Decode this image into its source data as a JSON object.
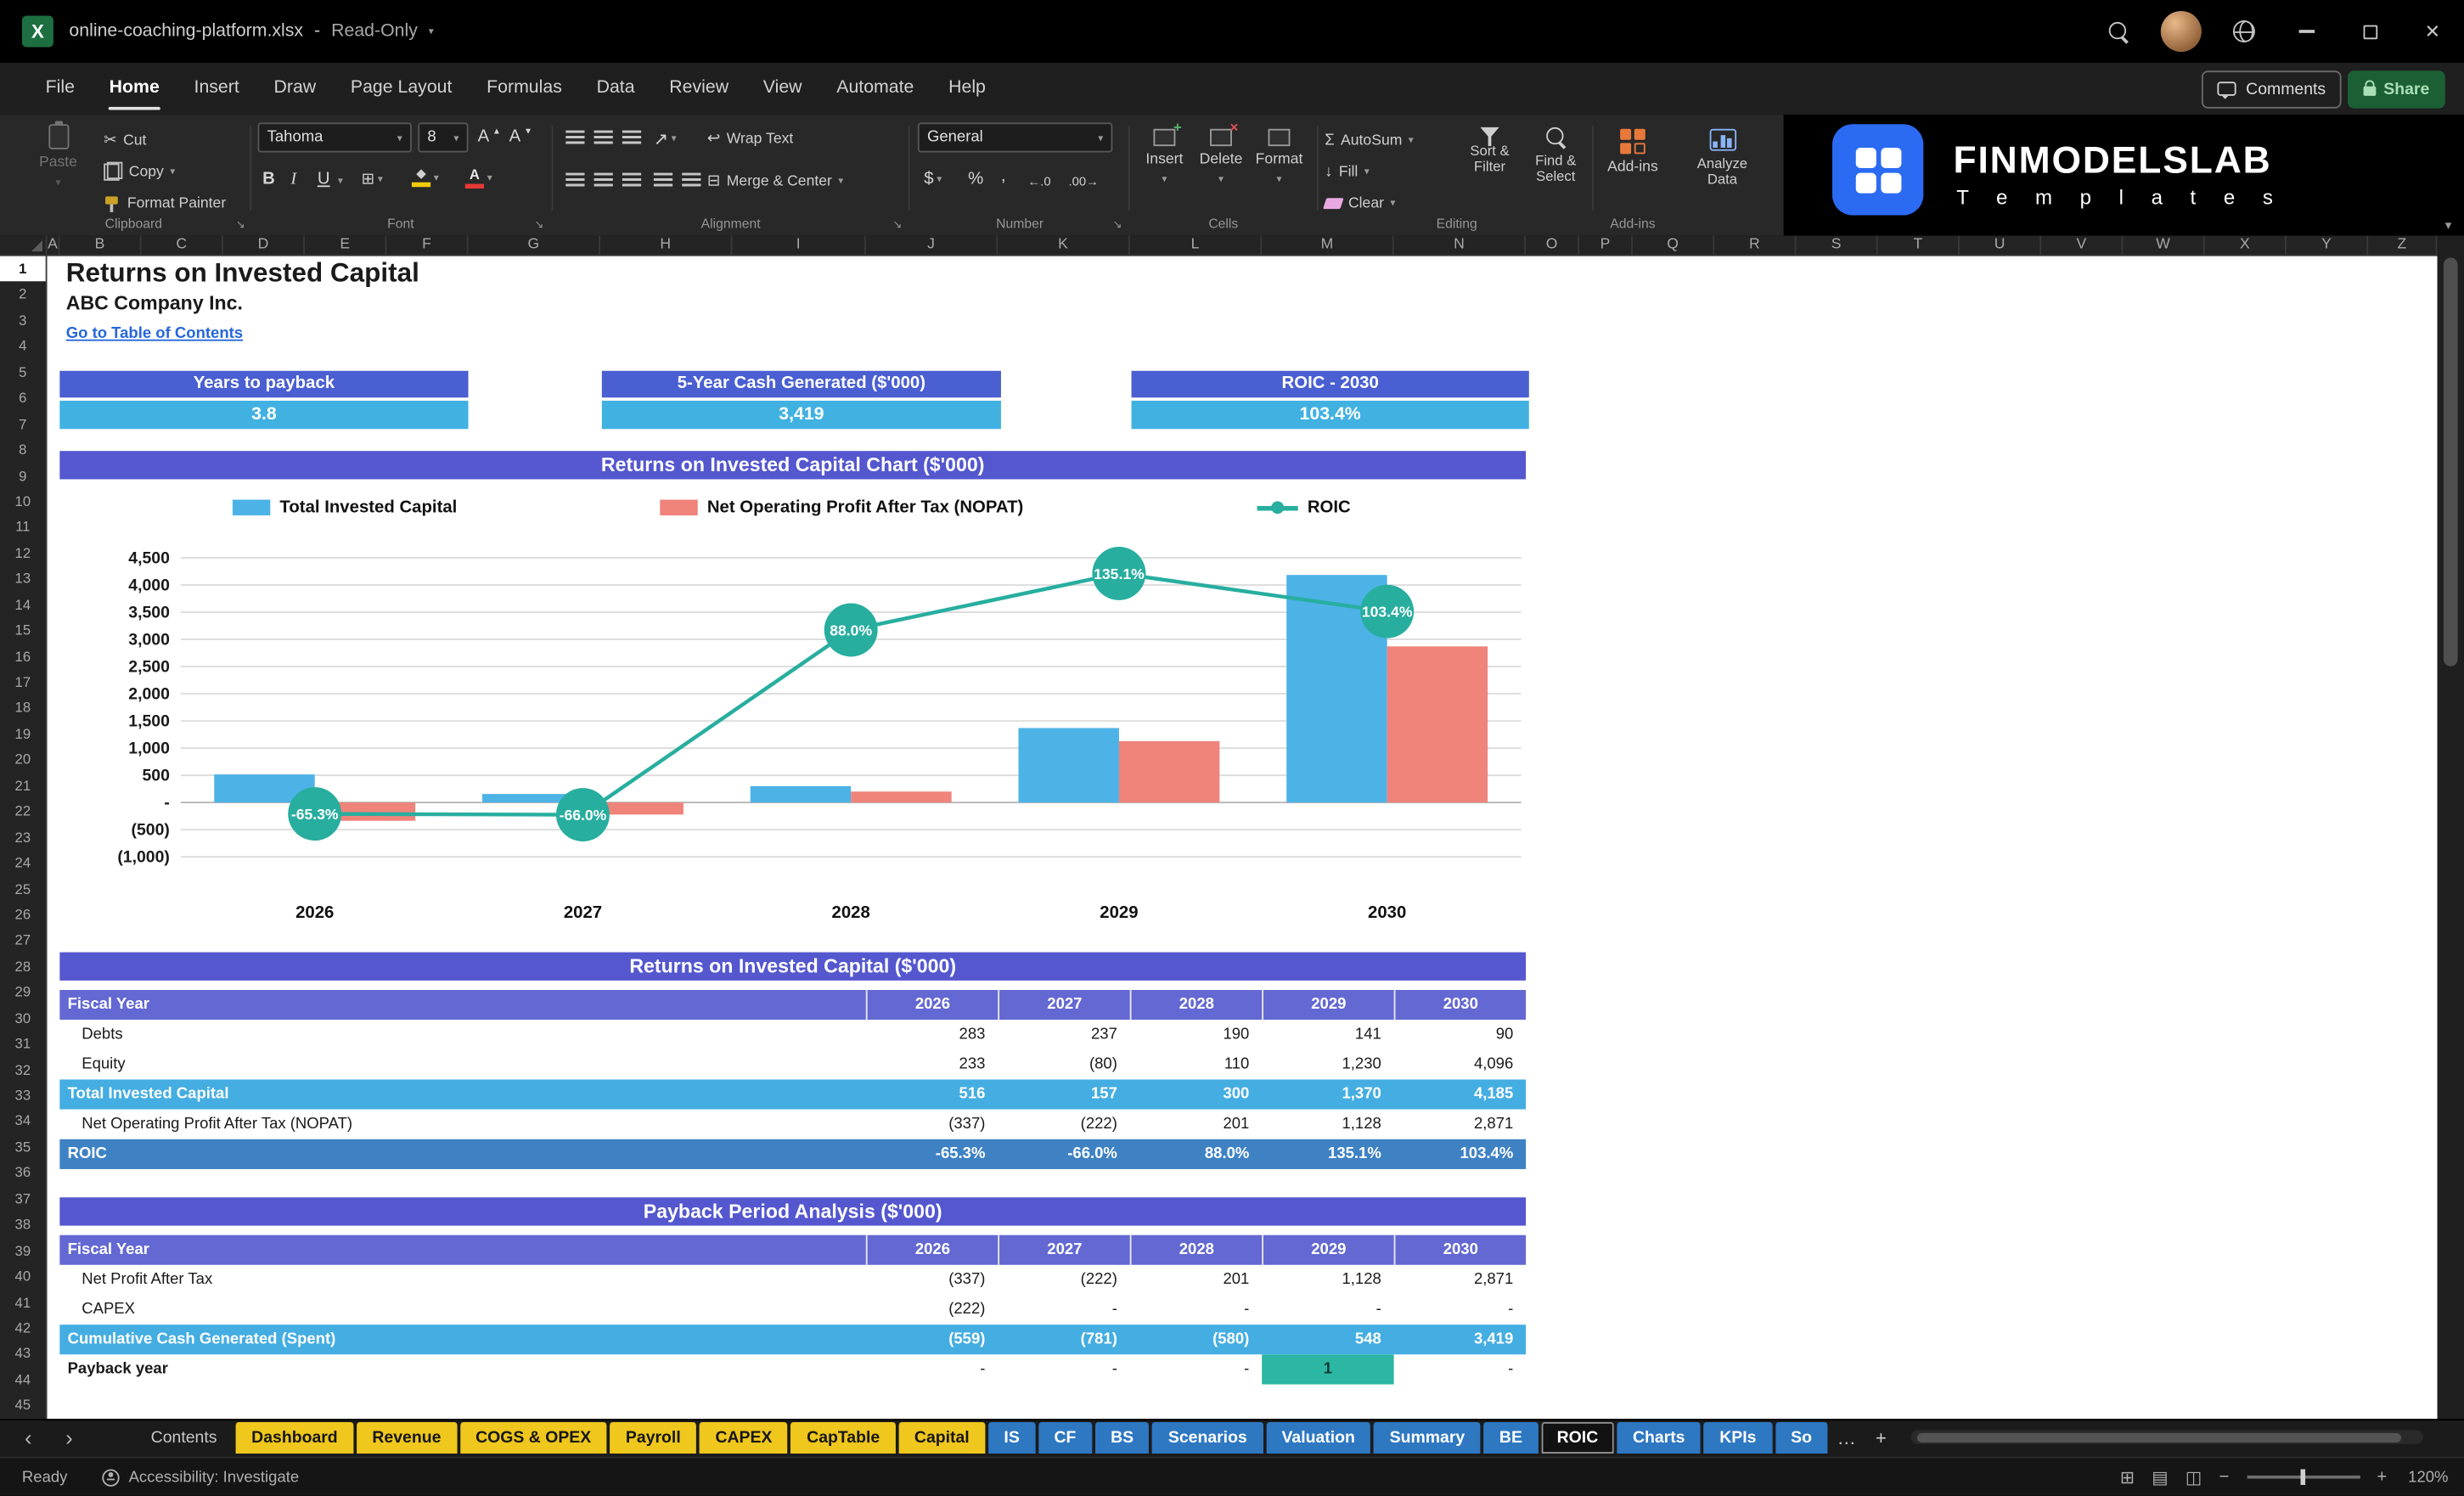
{
  "colors": {
    "banner": "#5457CE",
    "tableHeader": "#6468D2",
    "totalRow": "#44ADE2",
    "roicRow": "#3E82C4",
    "kpiHeader": "#4A5FD1",
    "kpiValue": "#41B1E1",
    "barBlue": "#4DB3E6",
    "barSalmon": "#F0837A",
    "teal": "#27AE9F",
    "tabYellow": "#EFC71D",
    "tabBlue": "#2E78C2",
    "link": "#2667D9",
    "payback": "#2CB6A4",
    "excelGreen": "#1D6F42",
    "brandBlue": "#2B6BF3"
  },
  "title_bar": {
    "file_name": "online-coaching-platform.xlsx",
    "separator": "-",
    "mode": "Read-Only"
  },
  "menu": {
    "items": [
      "File",
      "Home",
      "Insert",
      "Draw",
      "Page Layout",
      "Formulas",
      "Data",
      "Review",
      "View",
      "Automate",
      "Help"
    ],
    "active": "Home",
    "comments_label": "Comments",
    "share_label": "Share"
  },
  "ribbon": {
    "clipboard": {
      "label": "Clipboard",
      "paste": "Paste",
      "cut": "Cut",
      "copy": "Copy",
      "format_painter": "Format Painter"
    },
    "font": {
      "label": "Font",
      "family": "Tahoma",
      "size": "8",
      "bold": "B",
      "italic": "I",
      "underline": "U"
    },
    "alignment": {
      "label": "Alignment",
      "wrap_text": "Wrap Text",
      "merge_center": "Merge & Center"
    },
    "number": {
      "label": "Number",
      "format": "General",
      "currency": "$",
      "percent": "%",
      "comma": ","
    },
    "cells": {
      "label": "Cells",
      "insert": "Insert",
      "delete": "Delete",
      "format": "Format"
    },
    "editing": {
      "label": "Editing",
      "autosum": "AutoSum",
      "fill": "Fill",
      "clear": "Clear",
      "sort_filter": "Sort & Filter",
      "find_select": "Find & Select"
    },
    "addins": {
      "label": "Add-ins",
      "addins": "Add-ins",
      "analyze_data": "Analyze Data"
    }
  },
  "brand": {
    "name": "FINMODELSLAB",
    "subtitle": "T e m p l a t e s"
  },
  "grid": {
    "columns": [
      "A",
      "B",
      "C",
      "D",
      "E",
      "F",
      "G",
      "H",
      "I",
      "J",
      "K",
      "L",
      "M",
      "N",
      "O",
      "P",
      "Q",
      "R",
      "S",
      "T",
      "U",
      "V",
      "W",
      "X",
      "Y",
      "Z"
    ],
    "first_row": 1,
    "last_row": 45,
    "active_row": 1
  },
  "sheet": {
    "title": "Returns on Invested Capital",
    "company": "ABC Company Inc.",
    "toc_link": "Go to Table of Contents",
    "kpis": [
      {
        "label": "Years to payback",
        "value": "3.8"
      },
      {
        "label": "5-Year Cash Generated ($'000)",
        "value": "3,419"
      },
      {
        "label": "ROIC - 2030",
        "value": "103.4%"
      }
    ]
  },
  "chart_data": {
    "type": "bar+line",
    "title": "Returns on Invested Capital Chart ($'000)",
    "categories": [
      "2026",
      "2027",
      "2028",
      "2029",
      "2030"
    ],
    "series": [
      {
        "name": "Total Invested Capital",
        "type": "bar",
        "values": [
          516,
          157,
          300,
          1370,
          4185
        ]
      },
      {
        "name": "Net Operating Profit After Tax (NOPAT)",
        "type": "bar",
        "values": [
          -337,
          -222,
          201,
          1128,
          2871
        ]
      },
      {
        "name": "ROIC",
        "type": "line",
        "unit": "%",
        "values": [
          -65.3,
          -66.0,
          88.0,
          135.1,
          103.4
        ],
        "labels": [
          "-65.3%",
          "-66.0%",
          "88.0%",
          "135.1%",
          "103.4%"
        ]
      }
    ],
    "y_axis": {
      "min": -1000,
      "max": 4500,
      "step": 500,
      "tick_labels": [
        "4,500",
        "4,000",
        "3,500",
        "3,000",
        "2,500",
        "2,000",
        "1,500",
        "1,000",
        "500",
        "-",
        "(500)",
        "(1,000)"
      ]
    },
    "legend_position": "top",
    "gridlines": true
  },
  "table1": {
    "title": "Returns on Invested Capital ($'000)",
    "header": [
      "Fiscal Year",
      "2026",
      "2027",
      "2028",
      "2029",
      "2030"
    ],
    "rows": [
      {
        "label": "Debts",
        "values": [
          "283",
          "237",
          "190",
          "141",
          "90"
        ],
        "style": "plain"
      },
      {
        "label": "Equity",
        "values": [
          "233",
          "(80)",
          "110",
          "1,230",
          "4,096"
        ],
        "style": "plain"
      },
      {
        "label": "Total Invested Capital",
        "values": [
          "516",
          "157",
          "300",
          "1,370",
          "4,185"
        ],
        "style": "total"
      },
      {
        "label": "Net Operating Profit After Tax (NOPAT)",
        "values": [
          "(337)",
          "(222)",
          "201",
          "1,128",
          "2,871"
        ],
        "style": "plain"
      },
      {
        "label": "ROIC",
        "values": [
          "-65.3%",
          "-66.0%",
          "88.0%",
          "135.1%",
          "103.4%"
        ],
        "style": "roic"
      }
    ]
  },
  "table2": {
    "title": "Payback Period Analysis ($'000)",
    "header": [
      "Fiscal Year",
      "2026",
      "2027",
      "2028",
      "2029",
      "2030"
    ],
    "rows": [
      {
        "label": "Net Profit After Tax",
        "values": [
          "(337)",
          "(222)",
          "201",
          "1,128",
          "2,871"
        ],
        "style": "plain"
      },
      {
        "label": "CAPEX",
        "values": [
          "(222)",
          "-",
          "-",
          "-",
          "-"
        ],
        "style": "plain"
      },
      {
        "label": "Cumulative Cash Generated (Spent)",
        "values": [
          "(559)",
          "(781)",
          "(580)",
          "548",
          "3,419"
        ],
        "style": "total"
      },
      {
        "label": "Payback year",
        "values": [
          "-",
          "-",
          "-",
          "1",
          "-"
        ],
        "style": "payback",
        "highlight_col": 3
      }
    ]
  },
  "sheet_tabs": {
    "tabs": [
      {
        "label": "Contents",
        "style": "plain"
      },
      {
        "label": "Dashboard",
        "style": "yellow"
      },
      {
        "label": "Revenue",
        "style": "yellow"
      },
      {
        "label": "COGS & OPEX",
        "style": "yellow"
      },
      {
        "label": "Payroll",
        "style": "yellow"
      },
      {
        "label": "CAPEX",
        "style": "yellow"
      },
      {
        "label": "CapTable",
        "style": "yellow"
      },
      {
        "label": "Capital",
        "style": "yellow"
      },
      {
        "label": "IS",
        "style": "blue"
      },
      {
        "label": "CF",
        "style": "blue"
      },
      {
        "label": "BS",
        "style": "blue"
      },
      {
        "label": "Scenarios",
        "style": "blue"
      },
      {
        "label": "Valuation",
        "style": "blue"
      },
      {
        "label": "Summary",
        "style": "blue"
      },
      {
        "label": "BE",
        "style": "blue"
      },
      {
        "label": "ROIC",
        "style": "active"
      },
      {
        "label": "Charts",
        "style": "blue"
      },
      {
        "label": "KPIs",
        "style": "blue"
      },
      {
        "label": "So",
        "style": "blue"
      }
    ],
    "overflow": "…",
    "add": "+"
  },
  "status_bar": {
    "ready": "Ready",
    "accessibility": "Accessibility: Investigate",
    "zoom": "120%"
  }
}
